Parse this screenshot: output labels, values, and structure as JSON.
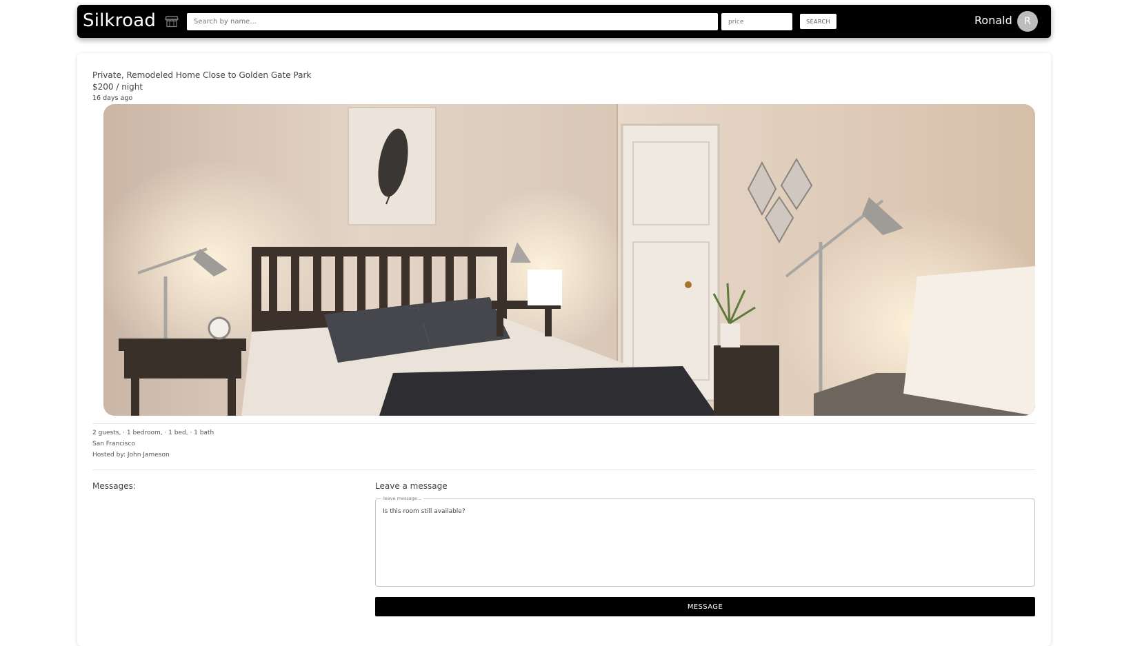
{
  "navbar": {
    "brand": "Silkroad",
    "search_placeholder": "Search by name...",
    "price_placeholder": "price",
    "search_button": "SEARCH",
    "username": "Ronald",
    "avatar_initial": "R",
    "icons": {
      "store": "storefront-icon"
    }
  },
  "listing": {
    "title": "Private, Remodeled Home Close to Golden Gate Park",
    "price": "$200 / night",
    "posted": "16 days ago",
    "photo": "bedroom-photo",
    "details": {
      "rooms": "2 guests, · 1 bedroom, · 1 bed, · 1 bath",
      "city": "San Francisco",
      "host": "Hosted by: John Jameson"
    }
  },
  "messages": {
    "label": "Messages:",
    "leave_label": "Leave a message",
    "field_label": "leave message...",
    "field_value": "Is this room still available?",
    "button": "MESSAGE"
  },
  "colors": {
    "navbar": "#000000",
    "accent": "#000000",
    "card": "#ffffff"
  }
}
